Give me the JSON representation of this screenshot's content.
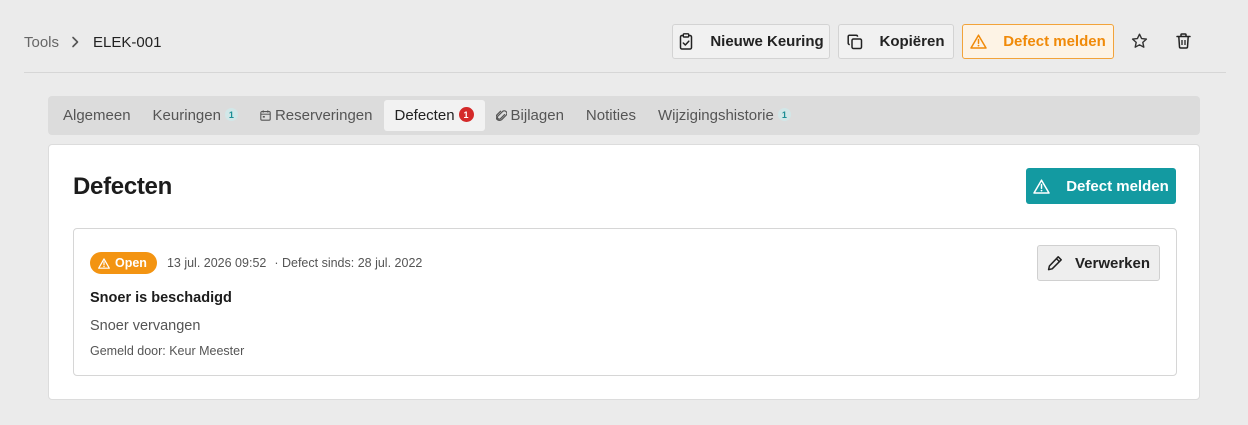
{
  "breadcrumb": {
    "root": "Tools",
    "current": "ELEK-001"
  },
  "header_actions": {
    "new_inspection": "Nieuwe Keuring",
    "copy": "Kopiëren",
    "report_defect": "Defect melden"
  },
  "tabs": [
    {
      "label": "Algemeen",
      "count": null,
      "icon": null,
      "active": false
    },
    {
      "label": "Keuringen",
      "count": "1",
      "icon": null,
      "active": false
    },
    {
      "label": "Reserveringen",
      "count": null,
      "icon": "calendar-icon",
      "active": false
    },
    {
      "label": "Defecten",
      "count": "1",
      "icon": null,
      "active": true
    },
    {
      "label": "Bijlagen",
      "count": null,
      "icon": "paperclip-icon",
      "active": false
    },
    {
      "label": "Notities",
      "count": null,
      "icon": null,
      "active": false
    },
    {
      "label": "Wijzigingshistorie",
      "count": "1",
      "icon": null,
      "active": false
    }
  ],
  "panel": {
    "title": "Defecten",
    "report_button": "Defect melden"
  },
  "defect": {
    "status": "Open",
    "timestamp": "13 jul. 2026 09:52",
    "since": "· Defect sinds: 28 jul. 2022",
    "process_button": "Verwerken",
    "title": "Snoer is beschadigd",
    "description": "Snoer vervangen",
    "reported_by": "Gemeld door: Keur Meester"
  },
  "colors": {
    "accent_teal": "#139aa1",
    "warning_orange": "#f39412",
    "badge_red": "#d42929"
  }
}
